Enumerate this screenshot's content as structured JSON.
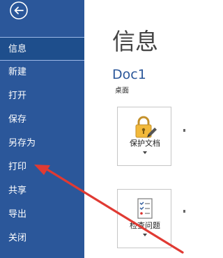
{
  "sidebar": {
    "back_icon": "back-arrow-icon",
    "items": [
      {
        "label": "信息",
        "selected": true
      },
      {
        "label": "新建",
        "selected": false
      },
      {
        "label": "打开",
        "selected": false
      },
      {
        "label": "保存",
        "selected": false
      },
      {
        "label": "另存为",
        "selected": false
      },
      {
        "label": "打印",
        "selected": false
      },
      {
        "label": "共享",
        "selected": false
      },
      {
        "label": "导出",
        "selected": false
      },
      {
        "label": "关闭",
        "selected": false
      }
    ]
  },
  "main": {
    "title": "信息",
    "document_name": "Doc1",
    "document_location": "桌面",
    "protect": {
      "label": "保护文档",
      "icon": "lock-icon"
    },
    "inspect": {
      "label": "检查问题",
      "icon": "checklist-icon"
    }
  },
  "annotation": {
    "type": "red-arrow",
    "target": "打印",
    "color": "#e03a33"
  },
  "colors": {
    "sidebar": "#2b579a",
    "selected": "#1e4e8c",
    "accent": "#2b579a"
  }
}
